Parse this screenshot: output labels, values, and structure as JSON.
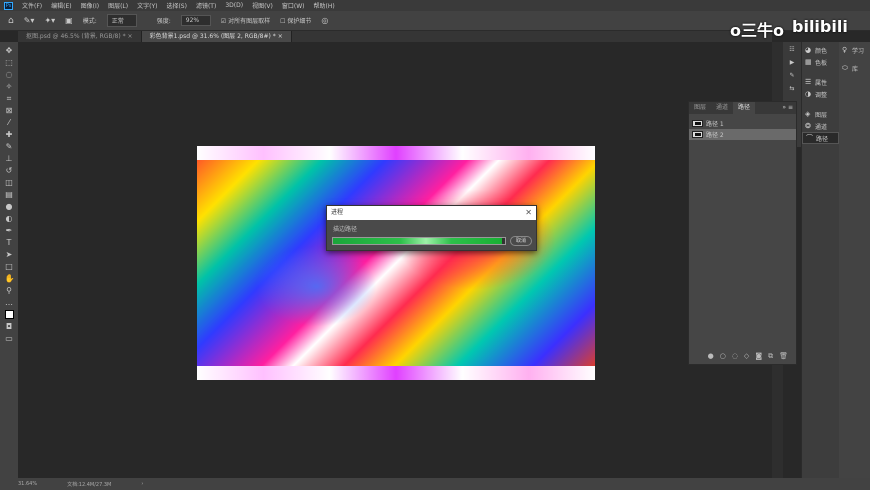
{
  "menu": {
    "logo": "Ps",
    "items": [
      "文件(F)",
      "编辑(E)",
      "图像(I)",
      "图层(L)",
      "文字(Y)",
      "选择(S)",
      "滤镜(T)",
      "3D(D)",
      "视图(V)",
      "窗口(W)",
      "帮助(H)"
    ]
  },
  "options": {
    "mode_label": "模式:",
    "mode_value": "正常",
    "opacity_label": "强度:",
    "opacity_value": "92%",
    "sample_all": "对所有图层取样",
    "sample_all_checked": true,
    "protect": "保护细节"
  },
  "tabs": [
    {
      "label": "抠图.psd @ 46.5% (背景, RGB/8) *",
      "active": false
    },
    {
      "label": "彩色背景1.psd @ 31.6% (图层 2, RGB/8#) *",
      "active": true
    }
  ],
  "dialog": {
    "title": "进程",
    "message": "描边路径",
    "progress": 0.98,
    "cancel": "取消",
    "accent": "#1aa63a"
  },
  "right_panel": {
    "items": [
      {
        "icon": "color-icon",
        "label": "颜色"
      },
      {
        "icon": "swatches-icon",
        "label": "色板"
      },
      {
        "icon": "properties-icon",
        "label": "属性"
      },
      {
        "icon": "adjustments-icon",
        "label": "调整"
      },
      {
        "icon": "layers-icon",
        "label": "图层"
      },
      {
        "icon": "channels-icon",
        "label": "通道"
      },
      {
        "icon": "paths-icon",
        "label": "路径",
        "active": true
      }
    ],
    "extra": [
      {
        "icon": "learn-icon",
        "label": "学习"
      },
      {
        "icon": "libraries-icon",
        "label": "库"
      }
    ]
  },
  "paths_panel": {
    "tabs": [
      "图层",
      "通道",
      "路径"
    ],
    "active_tab": 2,
    "rows": [
      "路径 1",
      "路径 2"
    ],
    "selected_row": 1
  },
  "status": {
    "zoom": "31.64%",
    "doc": "文档:12.4M/27.3M"
  },
  "watermark": {
    "left": "o三牛o",
    "right": "bilibili"
  }
}
